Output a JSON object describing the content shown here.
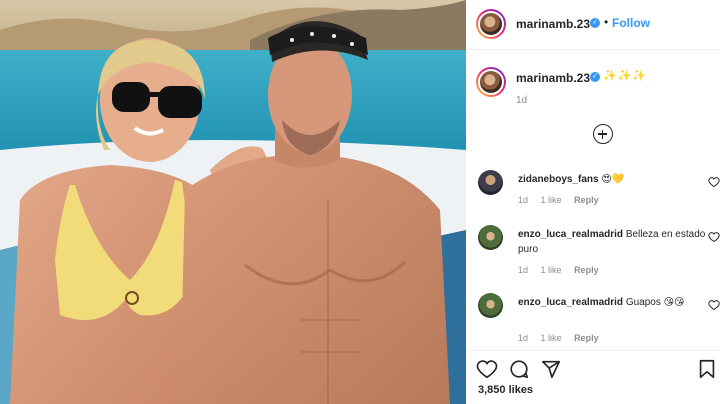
{
  "header": {
    "username": "marinamb.23",
    "verified_mark": "✓",
    "separator": "•",
    "follow_label": "Follow"
  },
  "caption": {
    "username": "marinamb.23",
    "verified_mark": "✓",
    "text": "✨✨✨",
    "time": "1d"
  },
  "comments": [
    {
      "username": "zidaneboys_fans",
      "text": " 😍💛",
      "time": "1d",
      "likes": "1 like",
      "reply": "Reply"
    },
    {
      "username": "enzo_luca_realmadrid",
      "text": " Belleza en estado puro",
      "time": "1d",
      "likes": "1 like",
      "reply": "Reply"
    },
    {
      "username": "enzo_luca_realmadrid",
      "text": " Guapos 😘😘",
      "time": "1d",
      "likes": "1 like",
      "reply": "Reply"
    }
  ],
  "actions": {
    "like_icon": "heart-icon",
    "comment_icon": "comment-icon",
    "share_icon": "share-icon",
    "save_icon": "bookmark-icon"
  },
  "likes_count": "3,850 likes",
  "colors": {
    "link_blue": "#3897f0",
    "text": "#262626",
    "muted": "#8e8e8e",
    "divider": "#efefef"
  }
}
